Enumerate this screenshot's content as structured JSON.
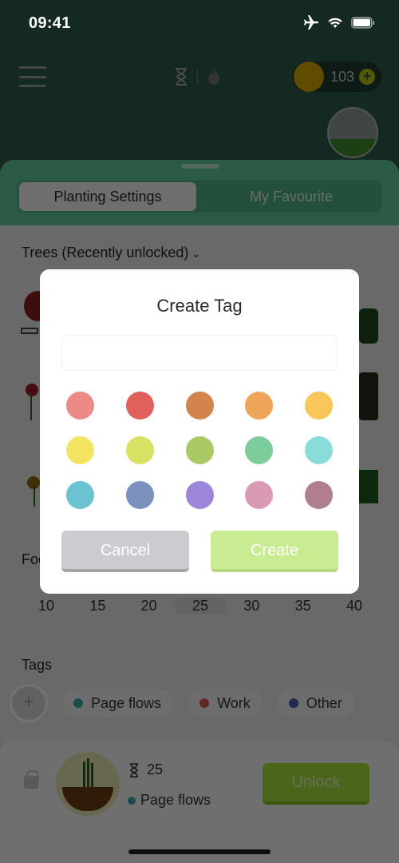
{
  "status_bar": {
    "time": "09:41",
    "icons": [
      "airplane-icon",
      "wifi-icon",
      "battery-icon"
    ]
  },
  "header": {
    "menu_icon": "hamburger-menu-icon",
    "mode_icons": [
      "hourglass-icon",
      "flame-icon"
    ],
    "coins": {
      "count": "103",
      "add_icon": "plus-icon"
    },
    "plant_icon": "sprout-icon"
  },
  "sheet": {
    "tabs": [
      {
        "label": "Planting Settings",
        "active": true
      },
      {
        "label": "My Favourite",
        "active": false
      }
    ],
    "trees_title": "Trees (Recently unlocked)",
    "focus_title": "Focus",
    "durations": [
      "10",
      "15",
      "20",
      "25",
      "30",
      "35",
      "40"
    ],
    "selected_duration": "25",
    "tags_title": "Tags",
    "tags": [
      {
        "label": "Page flows",
        "color": "#3aa8a6"
      },
      {
        "label": "Work",
        "color": "#e05a5a"
      },
      {
        "label": "Other",
        "color": "#4a5fa6"
      }
    ]
  },
  "bottom_card": {
    "duration": "25",
    "tag": "Page flows",
    "unlock_label": "Unlock"
  },
  "modal": {
    "title": "Create Tag",
    "input_value": "",
    "input_placeholder": "",
    "colors": [
      "#ec8a85",
      "#e0605c",
      "#d3834d",
      "#eea55a",
      "#f9c65a",
      "#f2e360",
      "#d6e263",
      "#a9c965",
      "#7dcc9b",
      "#8adcd9",
      "#6bc2d0",
      "#7a91bd",
      "#9b86d8",
      "#da9ab6",
      "#b07e90"
    ],
    "cancel_label": "Cancel",
    "create_label": "Create"
  }
}
